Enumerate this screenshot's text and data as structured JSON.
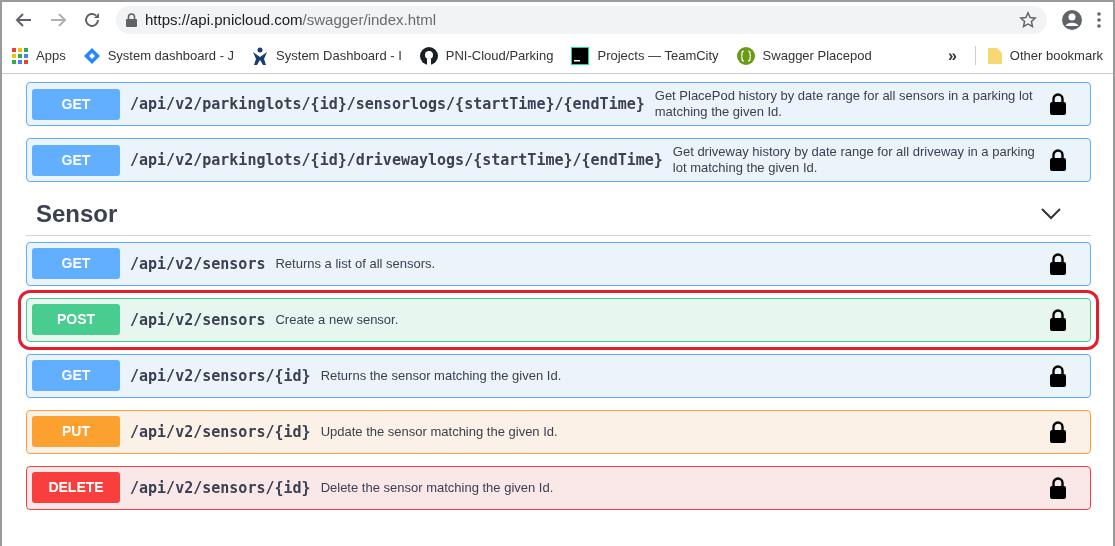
{
  "browser": {
    "url_host": "https://api.pnicloud.com",
    "url_path": "/swagger/index.html",
    "bookmarks": [
      {
        "label": "Apps",
        "kind": "apps"
      },
      {
        "label": "System dashboard - J",
        "kind": "diamond"
      },
      {
        "label": "System Dashboard - I",
        "kind": "figure"
      },
      {
        "label": "PNI-Cloud/Parking",
        "kind": "github"
      },
      {
        "label": "Projects — TeamCity",
        "kind": "tc"
      },
      {
        "label": "Swagger Placepod",
        "kind": "swagger"
      }
    ],
    "overflow": "»",
    "other_bookmarks": "Other bookmark"
  },
  "sections": [
    {
      "operations": [
        {
          "method": "GET",
          "path": "/api/v2/parkinglots/{id}/sensorlogs/{startTime}/{endTime}",
          "summary": "Get PlacePod history by date range for all sensors in a parking lot matching the given Id.",
          "highlighted": false
        },
        {
          "method": "GET",
          "path": "/api/v2/parkinglots/{id}/drivewaylogs/{startTime}/{endTime}",
          "summary": "Get driveway history by date range for all driveway in a parking lot matching the given Id.",
          "highlighted": false
        }
      ]
    },
    {
      "title": "Sensor",
      "expanded": true,
      "operations": [
        {
          "method": "GET",
          "path": "/api/v2/sensors",
          "summary": "Returns a list of all sensors.",
          "highlighted": false
        },
        {
          "method": "POST",
          "path": "/api/v2/sensors",
          "summary": "Create a new sensor.",
          "highlighted": true
        },
        {
          "method": "GET",
          "path": "/api/v2/sensors/{id}",
          "summary": "Returns the sensor matching the given Id.",
          "highlighted": false
        },
        {
          "method": "PUT",
          "path": "/api/v2/sensors/{id}",
          "summary": "Update the sensor matching the given Id.",
          "highlighted": false
        },
        {
          "method": "DELETE",
          "path": "/api/v2/sensors/{id}",
          "summary": "Delete the sensor matching the given Id.",
          "highlighted": false
        }
      ]
    }
  ]
}
